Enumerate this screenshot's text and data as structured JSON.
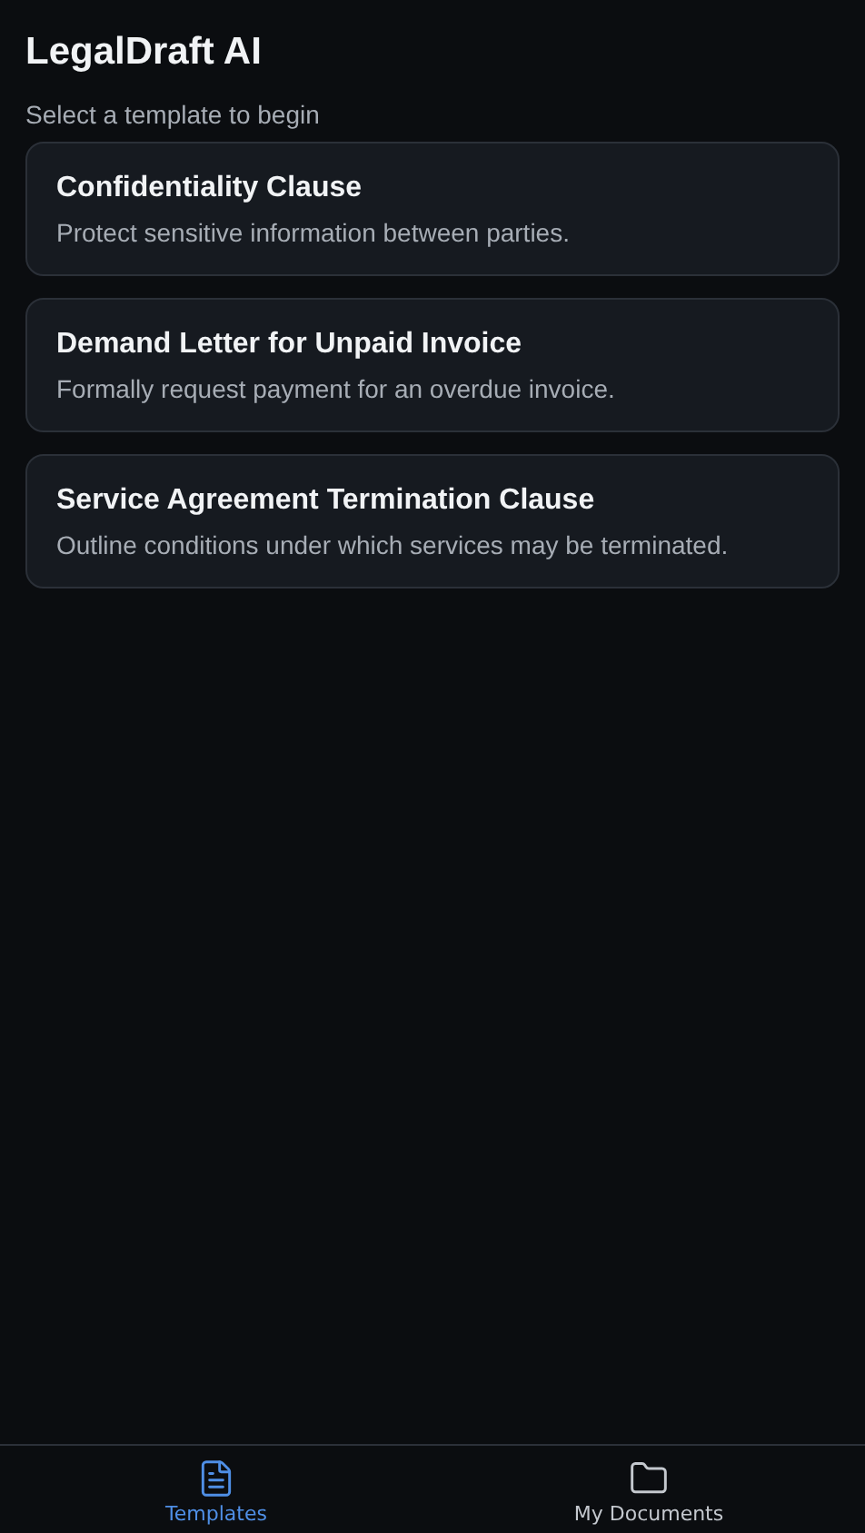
{
  "header": {
    "title": "LegalDraft AI",
    "subtitle": "Select a template to begin"
  },
  "templates": [
    {
      "title": "Confidentiality Clause",
      "description": "Protect sensitive information between parties."
    },
    {
      "title": "Demand Letter for Unpaid Invoice",
      "description": "Formally request payment for an overdue invoice."
    },
    {
      "title": "Service Agreement Termination Clause",
      "description": "Outline conditions under which services may be terminated."
    }
  ],
  "nav": [
    {
      "label": "Templates",
      "kind": "document",
      "selected": true
    },
    {
      "label": "My Documents",
      "kind": "folder",
      "selected": false
    }
  ]
}
